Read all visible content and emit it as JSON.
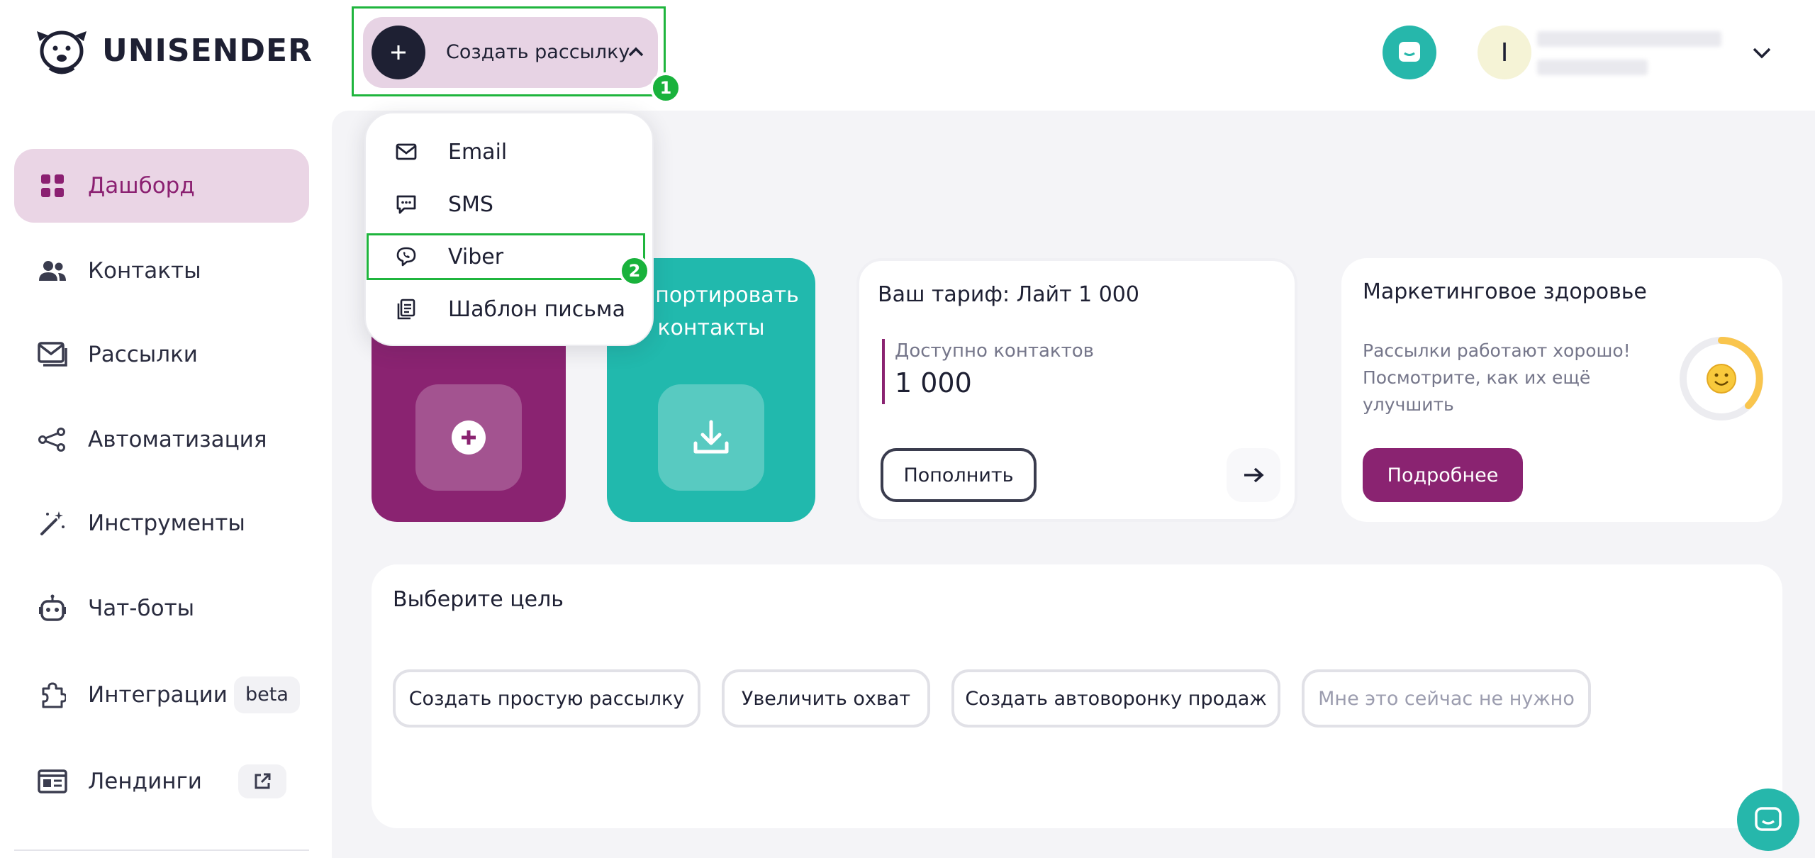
{
  "brand": {
    "name": "UNISENDER",
    "accent": "#8a2371",
    "teal": "#21b9ad"
  },
  "header": {
    "create_button_label": "Создать рассылку",
    "user_initial": "I",
    "markers": [
      "1",
      "2"
    ]
  },
  "dropdown": {
    "items": [
      {
        "label": "Email",
        "icon": "envelope-icon"
      },
      {
        "label": "SMS",
        "icon": "message-icon"
      },
      {
        "label": "Viber",
        "icon": "viber-icon"
      },
      {
        "label": "Шаблон письма",
        "icon": "template-icon"
      }
    ]
  },
  "sidebar": {
    "items": [
      {
        "label": "Дашборд",
        "icon": "grid-icon",
        "active": true
      },
      {
        "label": "Контакты",
        "icon": "users-icon"
      },
      {
        "label": "Рассылки",
        "icon": "mail-stack-icon"
      },
      {
        "label": "Автоматизация",
        "icon": "share-nodes-icon"
      },
      {
        "label": "Инструменты",
        "icon": "magic-wand-icon"
      },
      {
        "label": "Чат-боты",
        "icon": "robot-icon"
      },
      {
        "label": "Интеграции",
        "icon": "puzzle-icon",
        "badge": "beta"
      },
      {
        "label": "Лендинги",
        "icon": "landing-icon",
        "external": true
      }
    ]
  },
  "cards": {
    "import_title_line1": "Импортировать",
    "import_title_line2": "контакты",
    "tariff": {
      "title": "Ваш тариф: Лайт 1 000",
      "available_label": "Доступно контактов",
      "available_value": "1 000",
      "topup_label": "Пополнить"
    },
    "health": {
      "title": "Маркетинговое здоровье",
      "text": "Рассылки работают хорошо! Посмотрите, как их ещё улучшить",
      "more_label": "Подробнее",
      "gauge_fraction": 0.55
    }
  },
  "goal": {
    "title": "Выберите цель",
    "options": [
      {
        "label": "Создать простую рассылку"
      },
      {
        "label": "Увеличить охват"
      },
      {
        "label": "Создать автоворонку продаж"
      },
      {
        "label": "Мне это сейчас не нужно",
        "muted": true
      }
    ]
  }
}
